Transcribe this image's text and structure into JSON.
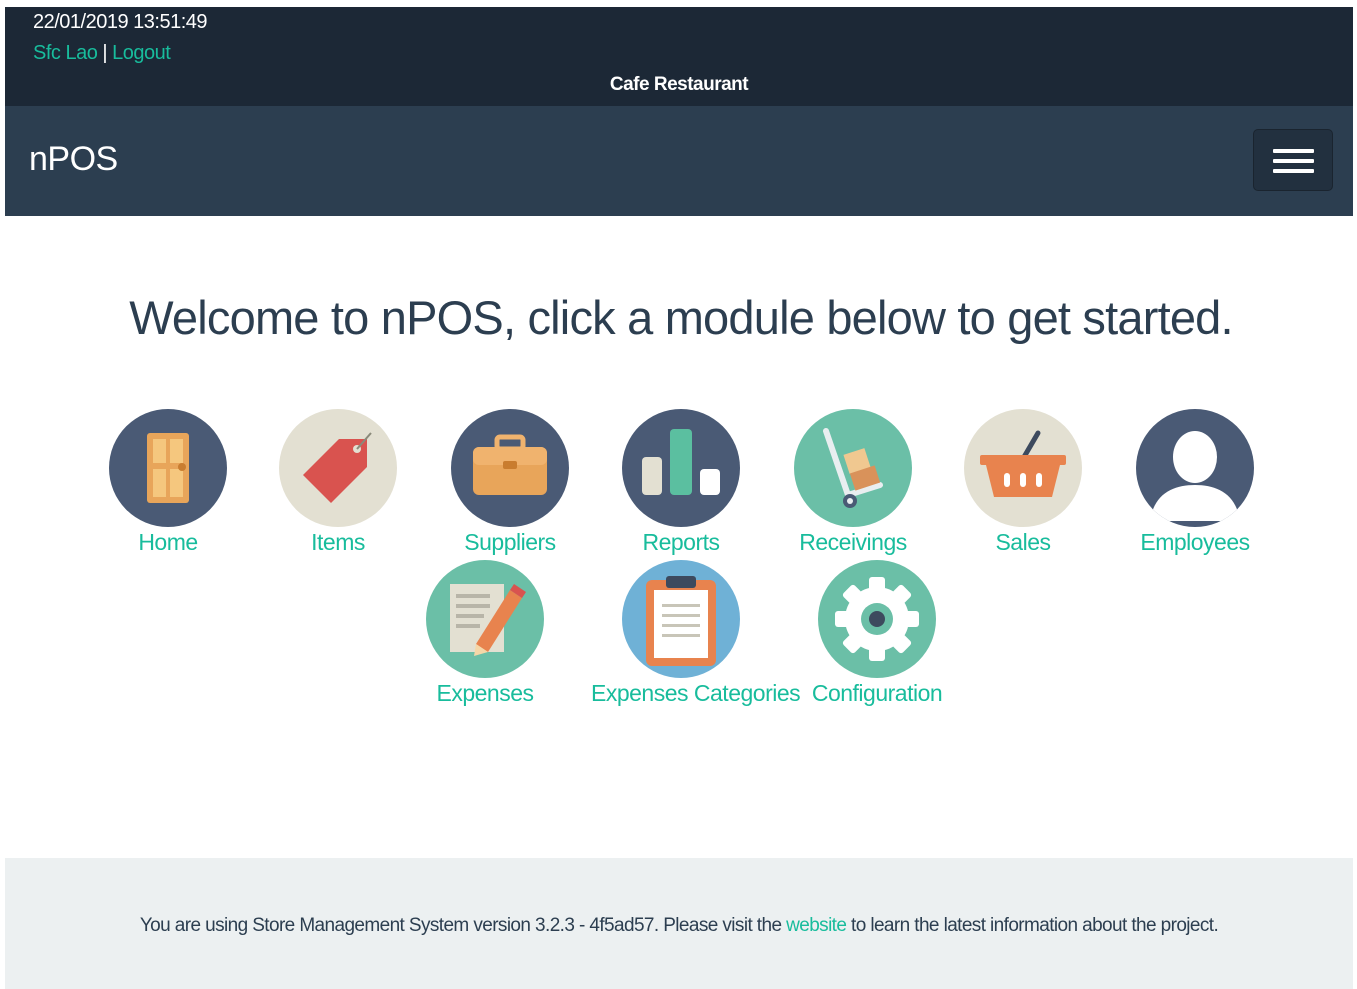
{
  "header": {
    "datetime": "22/01/2019 13:51:49",
    "user_name": "Sfc Lao",
    "separator": "|",
    "logout_label": "Logout",
    "store_name": "Cafe Restaurant"
  },
  "navbar": {
    "brand": "nPOS",
    "menu_icon": "hamburger-icon"
  },
  "main": {
    "welcome": "Welcome to nPOS, click a module below to get started."
  },
  "modules": [
    {
      "label": "Home",
      "icon": "door-icon",
      "color": "#4a5a75"
    },
    {
      "label": "Items",
      "icon": "price-tag-icon",
      "color": "#e3e0d2"
    },
    {
      "label": "Suppliers",
      "icon": "briefcase-icon",
      "color": "#4a5a75"
    },
    {
      "label": "Reports",
      "icon": "bar-chart-icon",
      "color": "#4a5a75"
    },
    {
      "label": "Receivings",
      "icon": "hand-truck-icon",
      "color": "#6bbfa7"
    },
    {
      "label": "Sales",
      "icon": "basket-icon",
      "color": "#e3e0d2"
    },
    {
      "label": "Employees",
      "icon": "user-icon",
      "color": "#4a5a75"
    },
    {
      "label": "Expenses",
      "icon": "document-pencil-icon",
      "color": "#6bbfa7"
    },
    {
      "label": "Expenses Categories",
      "icon": "clipboard-icon",
      "color": "#6fb1d6"
    },
    {
      "label": "Configuration",
      "icon": "gear-icon",
      "color": "#6bbfa7"
    }
  ],
  "footer": {
    "text_before": "You are using Store Management System version 3.2.3 - 4f5ad57. Please visit the ",
    "link_label": "website",
    "text_after": " to learn the latest information about the project."
  },
  "colors": {
    "topbar": "#1c2836",
    "navbar": "#2c3e50",
    "accent": "#18bc9c",
    "footer_bg": "#ecf0f1"
  }
}
